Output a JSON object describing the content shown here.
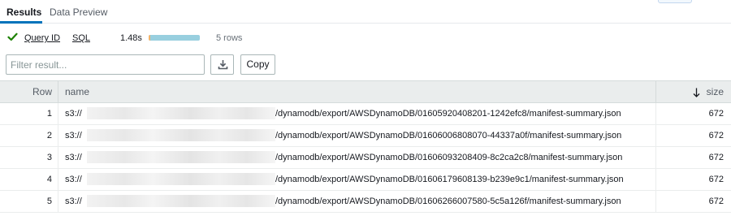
{
  "tabs": [
    {
      "label": "Results"
    },
    {
      "label": "Data Preview"
    }
  ],
  "query_info": {
    "query_id_label": "Query ID",
    "sql_label": "SQL",
    "elapsed": "1.48s",
    "row_count": "5 rows",
    "progress_fraction": 1.0
  },
  "toolbar": {
    "filter_placeholder": "Filter result...",
    "copy_label": "Copy"
  },
  "table": {
    "columns": {
      "row": "Row",
      "name": "name",
      "size": "size"
    },
    "sort": {
      "column": "size",
      "direction": "descending"
    },
    "rows": [
      {
        "row": "1",
        "prefix": "s3://",
        "path": "/dynamodb/export/AWSDynamoDB/01605920408201-1242efc8/manifest-summary.json",
        "size": "672"
      },
      {
        "row": "2",
        "prefix": "s3://",
        "path": "/dynamodb/export/AWSDynamoDB/01606006808070-44337a0f/manifest-summary.json",
        "size": "672"
      },
      {
        "row": "3",
        "prefix": "s3://",
        "path": "/dynamodb/export/AWSDynamoDB/01606093208409-8c2ca2c8/manifest-summary.json",
        "size": "672"
      },
      {
        "row": "4",
        "prefix": "s3://",
        "path": "/dynamodb/export/AWSDynamoDB/01606179608139-b239e9c1/manifest-summary.json",
        "size": "672"
      },
      {
        "row": "5",
        "prefix": "s3://",
        "path": "/dynamodb/export/AWSDynamoDB/01606266007580-5c5a126f/manifest-summary.json",
        "size": "672"
      }
    ]
  },
  "colors": {
    "success": "#1d8102",
    "tab_active": "#0073bb",
    "progress_fill": "#98cfdf"
  },
  "icons": {
    "status": "check-icon",
    "download": "download-icon",
    "sort": "arrow-down-icon"
  }
}
